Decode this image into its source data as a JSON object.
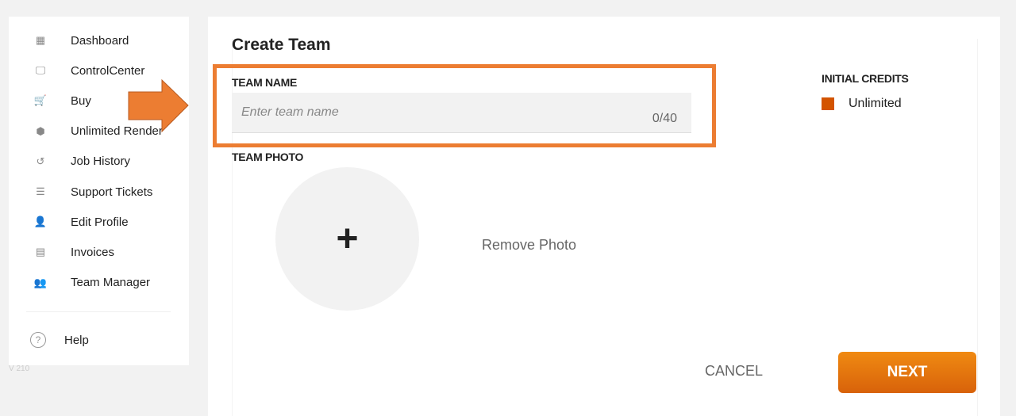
{
  "sidebar": {
    "items": [
      {
        "label": "Dashboard",
        "icon": "dashboard-icon",
        "glyph": "▦"
      },
      {
        "label": "ControlCenter",
        "icon": "monitor-icon",
        "glyph": "🖵"
      },
      {
        "label": "Buy",
        "icon": "cart-icon",
        "glyph": "🛒"
      },
      {
        "label": "Unlimited Render",
        "icon": "cube-icon",
        "glyph": "⬢"
      },
      {
        "label": "Job History",
        "icon": "history-icon",
        "glyph": "↺"
      },
      {
        "label": "Support Tickets",
        "icon": "checklist-icon",
        "glyph": "☰"
      },
      {
        "label": "Edit Profile",
        "icon": "user-edit-icon",
        "glyph": "👤"
      },
      {
        "label": "Invoices",
        "icon": "receipt-icon",
        "glyph": "▤"
      },
      {
        "label": "Team Manager",
        "icon": "team-icon",
        "glyph": "👥"
      }
    ],
    "help": "Help",
    "version": "V 210"
  },
  "form": {
    "title": "Create Team",
    "team_name_label": "TEAM NAME",
    "team_name_placeholder": "Enter team name",
    "team_name_value": "",
    "counter": "0/40",
    "team_photo_label": "TEAM PHOTO",
    "add_photo": "+",
    "remove_photo": "Remove Photo",
    "initial_credits_label": "INITIAL CREDITS",
    "credits_option": "Unlimited",
    "cancel": "CANCEL",
    "next": "NEXT"
  },
  "colors": {
    "accent": "#ec7d32",
    "button": "#e57310",
    "swatch": "#d35400"
  }
}
